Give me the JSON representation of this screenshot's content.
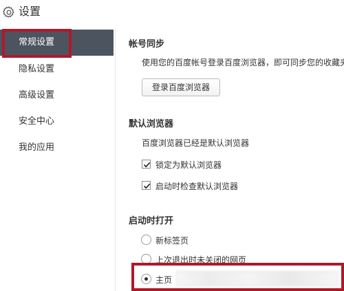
{
  "window": {
    "title": "设置",
    "icon": "gear-icon"
  },
  "sidebar": {
    "items": [
      {
        "label": "常规设置",
        "active": true
      },
      {
        "label": "隐私设置"
      },
      {
        "label": "高级设置"
      },
      {
        "label": "安全中心"
      },
      {
        "label": "我的应用"
      }
    ]
  },
  "sections": {
    "account_sync": {
      "title": "帐号同步",
      "description": "使用您的百度帐号登录百度浏览器，即可同步您的收藏夹",
      "login_button": "登录百度浏览器"
    },
    "default_browser": {
      "title": "默认浏览器",
      "status": "百度浏览器已经是默认浏览器",
      "options": [
        {
          "label": "锁定为默认浏览器",
          "checked": true
        },
        {
          "label": "启动时检查默认浏览器",
          "checked": true
        }
      ]
    },
    "startup": {
      "title": "启动时打开",
      "options": [
        {
          "label": "新标签页",
          "selected": false
        },
        {
          "label": "上次退出时未关闭的网页",
          "selected": false
        },
        {
          "label": "主页",
          "selected": true
        }
      ],
      "homepage_value": ""
    }
  },
  "colors": {
    "sidebar_active_bg": "#4c5460",
    "highlight_border": "#b0182a"
  }
}
